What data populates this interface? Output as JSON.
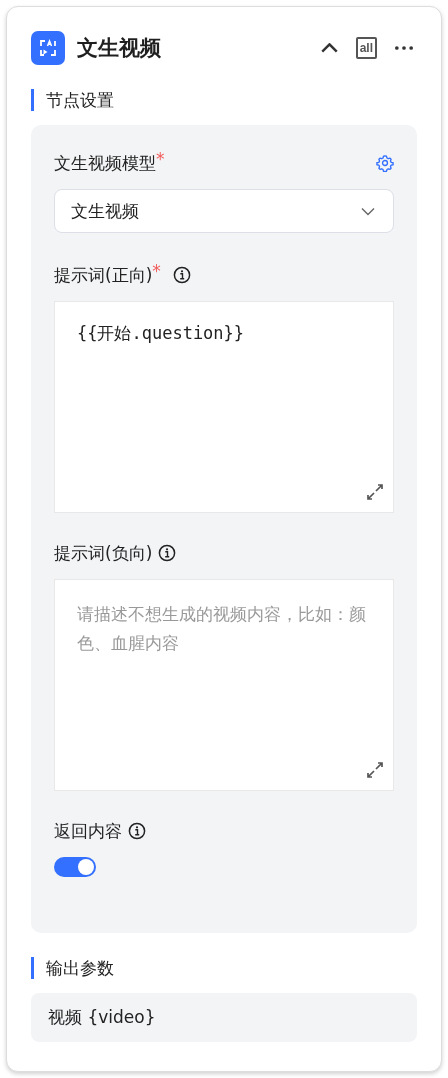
{
  "node": {
    "title": "文生视频",
    "view_badge": "all",
    "collapsed": false
  },
  "sections": [
    {
      "title": "节点设置",
      "kind": "settings"
    },
    {
      "title": "输出参数",
      "kind": "outputs"
    }
  ],
  "fields": [
    {
      "kind": "select",
      "label": "文生视频模型",
      "required": true,
      "info": false,
      "settings": true,
      "value": "文生视频"
    },
    {
      "kind": "textarea",
      "label": "提示词(正向)",
      "required": true,
      "info": true,
      "value": "{{开始.question}}"
    },
    {
      "kind": "textarea",
      "label": "提示词(负向)",
      "required": false,
      "info": true,
      "placeholder": "请描述不想生成的视频内容，比如：颜色、血腥内容"
    },
    {
      "kind": "switch",
      "label": "返回内容",
      "required": false,
      "info": true,
      "on": true
    }
  ],
  "required_mark": "*",
  "outputs": [
    {
      "label": "视频 {video}"
    }
  ]
}
